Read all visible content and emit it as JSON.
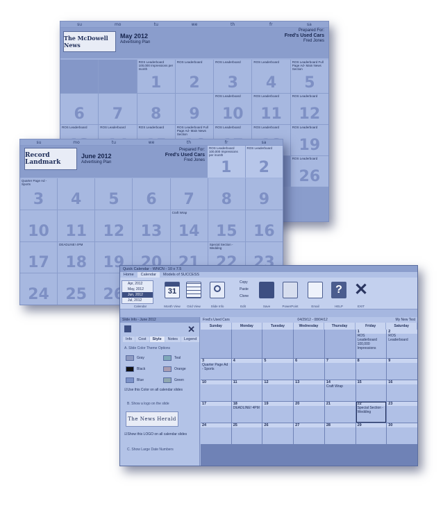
{
  "colors": {
    "slide_bg": "#9fb1dc",
    "header_bg": "#8a9dcc",
    "cell": "#a7b8e0",
    "accent_red": "#c0504d",
    "dark_text": "#15234b"
  },
  "days_short": [
    "su",
    "mo",
    "tu",
    "we",
    "th",
    "fr",
    "sa"
  ],
  "may_slide": {
    "logo": "The McDowell News",
    "month": "May 2012",
    "plan": "Advertising Plan",
    "prepared_for": "Prepared For:",
    "client": "Fred's Used Cars",
    "contact": "Fred Jones",
    "cells": [
      {
        "d": "",
        "n": ""
      },
      {
        "d": "",
        "n": ""
      },
      {
        "d": "1",
        "n": "ROS Leaderboard 100,000 Impressions per month"
      },
      {
        "d": "2",
        "n": "ROS Leaderboard"
      },
      {
        "d": "3",
        "n": "ROS Leaderboard"
      },
      {
        "d": "4",
        "n": "ROS Leaderboard"
      },
      {
        "d": "5",
        "n": "ROS Leaderboard Full Page Ad- Main News Section"
      },
      {
        "d": "6",
        "n": ""
      },
      {
        "d": "7",
        "n": ""
      },
      {
        "d": "8",
        "n": ""
      },
      {
        "d": "9",
        "n": ""
      },
      {
        "d": "10",
        "n": "ROS Leaderboard"
      },
      {
        "d": "11",
        "n": "ROS Leaderboard"
      },
      {
        "d": "12",
        "n": "ROS Leaderboard"
      },
      {
        "d": "13",
        "n": "ROS Leaderboard"
      },
      {
        "d": "14",
        "n": "ROS Leaderboard"
      },
      {
        "d": "15",
        "n": "ROS Leaderboard"
      },
      {
        "d": "16",
        "n": "ROS Leaderboard Full Page Ad- Main News Section"
      },
      {
        "d": "17",
        "n": "ROS Leaderboard"
      },
      {
        "d": "18",
        "n": "ROS Leaderboard"
      },
      {
        "d": "19",
        "n": "ROS Leaderboard"
      },
      {
        "d": "",
        "n": ""
      },
      {
        "d": "",
        "n": ""
      },
      {
        "d": "",
        "n": ""
      },
      {
        "d": "",
        "n": ""
      },
      {
        "d": "",
        "n": ""
      },
      {
        "d": "",
        "n": ""
      },
      {
        "d": "26",
        "n": "ROS Leaderboard"
      }
    ]
  },
  "june_slide": {
    "logo": "Record Landmark",
    "month": "June 2012",
    "plan": "Advertising Plan",
    "prepared_for": "Prepared For:",
    "client": "Fred's Used Cars",
    "contact": "Fred Jones",
    "top_cells": [
      {
        "d": "1",
        "n": "ROS Leaderboard 100,000 Impressions per month"
      },
      {
        "d": "2",
        "n": "ROS Leaderboard"
      }
    ],
    "cells": [
      {
        "d": "3",
        "n": "Quarter Page Ad - Sports"
      },
      {
        "d": "4",
        "n": ""
      },
      {
        "d": "5",
        "n": ""
      },
      {
        "d": "6",
        "n": ""
      },
      {
        "d": "7",
        "n": ""
      },
      {
        "d": "8",
        "n": ""
      },
      {
        "d": "9",
        "n": ""
      },
      {
        "d": "10",
        "n": ""
      },
      {
        "d": "11",
        "n": ""
      },
      {
        "d": "12",
        "n": ""
      },
      {
        "d": "13",
        "n": ""
      },
      {
        "d": "14",
        "n": "Craft Wrap"
      },
      {
        "d": "15",
        "n": ""
      },
      {
        "d": "16",
        "n": ""
      },
      {
        "d": "17",
        "n": ""
      },
      {
        "d": "18",
        "n": "DEADLINE! 4PM"
      },
      {
        "d": "19",
        "n": ""
      },
      {
        "d": "20",
        "n": ""
      },
      {
        "d": "21",
        "n": ""
      },
      {
        "d": "22",
        "n": "Special Section -Wedding"
      },
      {
        "d": "23",
        "n": ""
      },
      {
        "d": "24",
        "n": ""
      },
      {
        "d": "25",
        "n": ""
      },
      {
        "d": "26",
        "n": ""
      },
      {
        "d": "27",
        "n": ""
      },
      {
        "d": "28",
        "n": ""
      },
      {
        "d": "29",
        "n": ""
      },
      {
        "d": "30",
        "n": ""
      }
    ]
  },
  "app": {
    "title": "Quick Calendar - WNCN - 10 x 7.5",
    "tabs": [
      "Home",
      "Calendar",
      "Models of SUCCESS"
    ],
    "month_list": [
      "Apr, 2012",
      "May, 2012",
      "Jun, 2012",
      "Jul, 2012"
    ],
    "ribbon_groups": [
      "Calendar",
      "Month View",
      "Grid View",
      "Slide Info",
      "Edit",
      "Save",
      "PowerPoint",
      "Email",
      "HELP",
      "EXIT"
    ],
    "edit_items": [
      "Copy",
      "Paste",
      "Clone"
    ],
    "sidebar": {
      "title": "Slide Info - June 2012",
      "tabs": [
        "Info",
        "Cost",
        "Style",
        "Notes",
        "Legend"
      ],
      "section_a": "A. Slide Color Theme Options",
      "colors": [
        "Gray",
        "Teal",
        "Black",
        "Orange",
        "Blue",
        "Green"
      ],
      "use_color": "Use this Color on all calendar slides",
      "section_b": "B. Show a logo on the slide",
      "logo": "The News Herald",
      "show_logo": "Show this LOGO on all calendar slides",
      "section_c": "C. Show Large Date Numbers"
    },
    "calendar": {
      "client": "Fred's Used Cars",
      "range": "04/29/12 - 08/04/12",
      "test": "My New Test",
      "weekdays": [
        "Sunday",
        "Monday",
        "Tuesday",
        "Wednesday",
        "Thursday",
        "Friday",
        "Saturday"
      ],
      "cells": [
        {
          "d": "",
          "e": ""
        },
        {
          "d": "",
          "e": ""
        },
        {
          "d": "",
          "e": ""
        },
        {
          "d": "",
          "e": ""
        },
        {
          "d": "",
          "e": ""
        },
        {
          "d": "1",
          "e": "ROS Leaderboard 100,000 Impressions"
        },
        {
          "d": "2",
          "e": "ROS Leaderboard"
        },
        {
          "d": "3",
          "e": "Quarter Page Ad - Sports"
        },
        {
          "d": "4",
          "e": ""
        },
        {
          "d": "5",
          "e": ""
        },
        {
          "d": "6",
          "e": ""
        },
        {
          "d": "7",
          "e": ""
        },
        {
          "d": "8",
          "e": ""
        },
        {
          "d": "9",
          "e": ""
        },
        {
          "d": "10",
          "e": ""
        },
        {
          "d": "11",
          "e": ""
        },
        {
          "d": "12",
          "e": ""
        },
        {
          "d": "13",
          "e": ""
        },
        {
          "d": "14",
          "e": "Craft Wrap"
        },
        {
          "d": "15",
          "e": ""
        },
        {
          "d": "16",
          "e": ""
        },
        {
          "d": "17",
          "e": ""
        },
        {
          "d": "18",
          "e": "DEADLINE! 4PM"
        },
        {
          "d": "19",
          "e": ""
        },
        {
          "d": "20",
          "e": ""
        },
        {
          "d": "21",
          "e": ""
        },
        {
          "d": "22",
          "e": "Special Section -Wedding"
        },
        {
          "d": "23",
          "e": ""
        },
        {
          "d": "24",
          "e": ""
        },
        {
          "d": "25",
          "e": ""
        },
        {
          "d": "26",
          "e": ""
        },
        {
          "d": "27",
          "e": ""
        },
        {
          "d": "28",
          "e": ""
        },
        {
          "d": "29",
          "e": ""
        },
        {
          "d": "30",
          "e": ""
        }
      ]
    }
  }
}
